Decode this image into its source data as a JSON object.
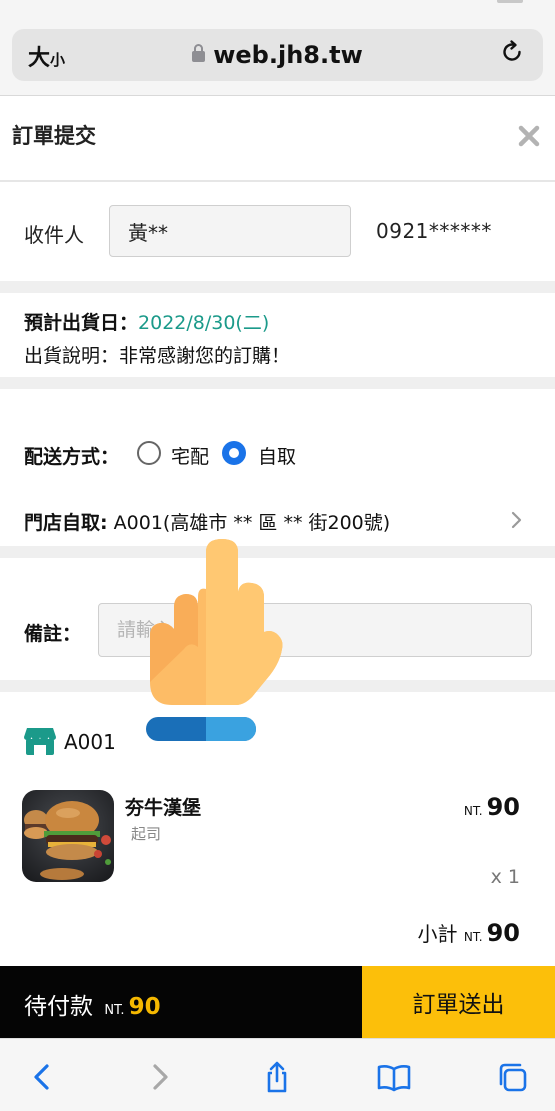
{
  "browser": {
    "text_size_big": "大",
    "text_size_small": "小",
    "url": "web.jh8.tw",
    "toolbar_icons": [
      "back-icon",
      "forward-icon",
      "share-icon",
      "bookmarks-icon",
      "tabs-icon"
    ]
  },
  "order": {
    "title": "訂單提交",
    "recipient_label": "收件人",
    "recipient_name": "黃**",
    "recipient_phone": "0921******",
    "ship_date_label": "預計出貨日：",
    "ship_date_value": "2022/8/30(二)",
    "ship_note": "出貨說明：非常感謝您的訂購！",
    "delivery_label": "配送方式：",
    "delivery_options": [
      "宅配",
      "自取"
    ],
    "delivery_selected": "自取",
    "store_pickup_label": "門店自取:",
    "store_pickup_value": "A001(高雄市 ** 區 ** 街200號)",
    "remark_label": "備註：",
    "remark_placeholder": "請輸入備註說明"
  },
  "store": {
    "code": "A001",
    "items": [
      {
        "name": "夯牛漢堡",
        "option": "起司",
        "currency": "NT.",
        "price": "90",
        "qty": "x 1"
      }
    ],
    "subtotal_label": "小計",
    "subtotal_currency": "NT.",
    "subtotal_value": "90"
  },
  "footer": {
    "pending_label": "待付款",
    "currency": "NT.",
    "total": "90",
    "submit_label": "訂單送出"
  },
  "colors": {
    "accent_teal": "#1b9a8a",
    "radio_blue": "#1a73e8",
    "submit_yellow": "#fcbf0a",
    "total_yellow": "#f5b800",
    "pay_bar": "#050505",
    "toolbar_blue": "#1a73e8"
  }
}
